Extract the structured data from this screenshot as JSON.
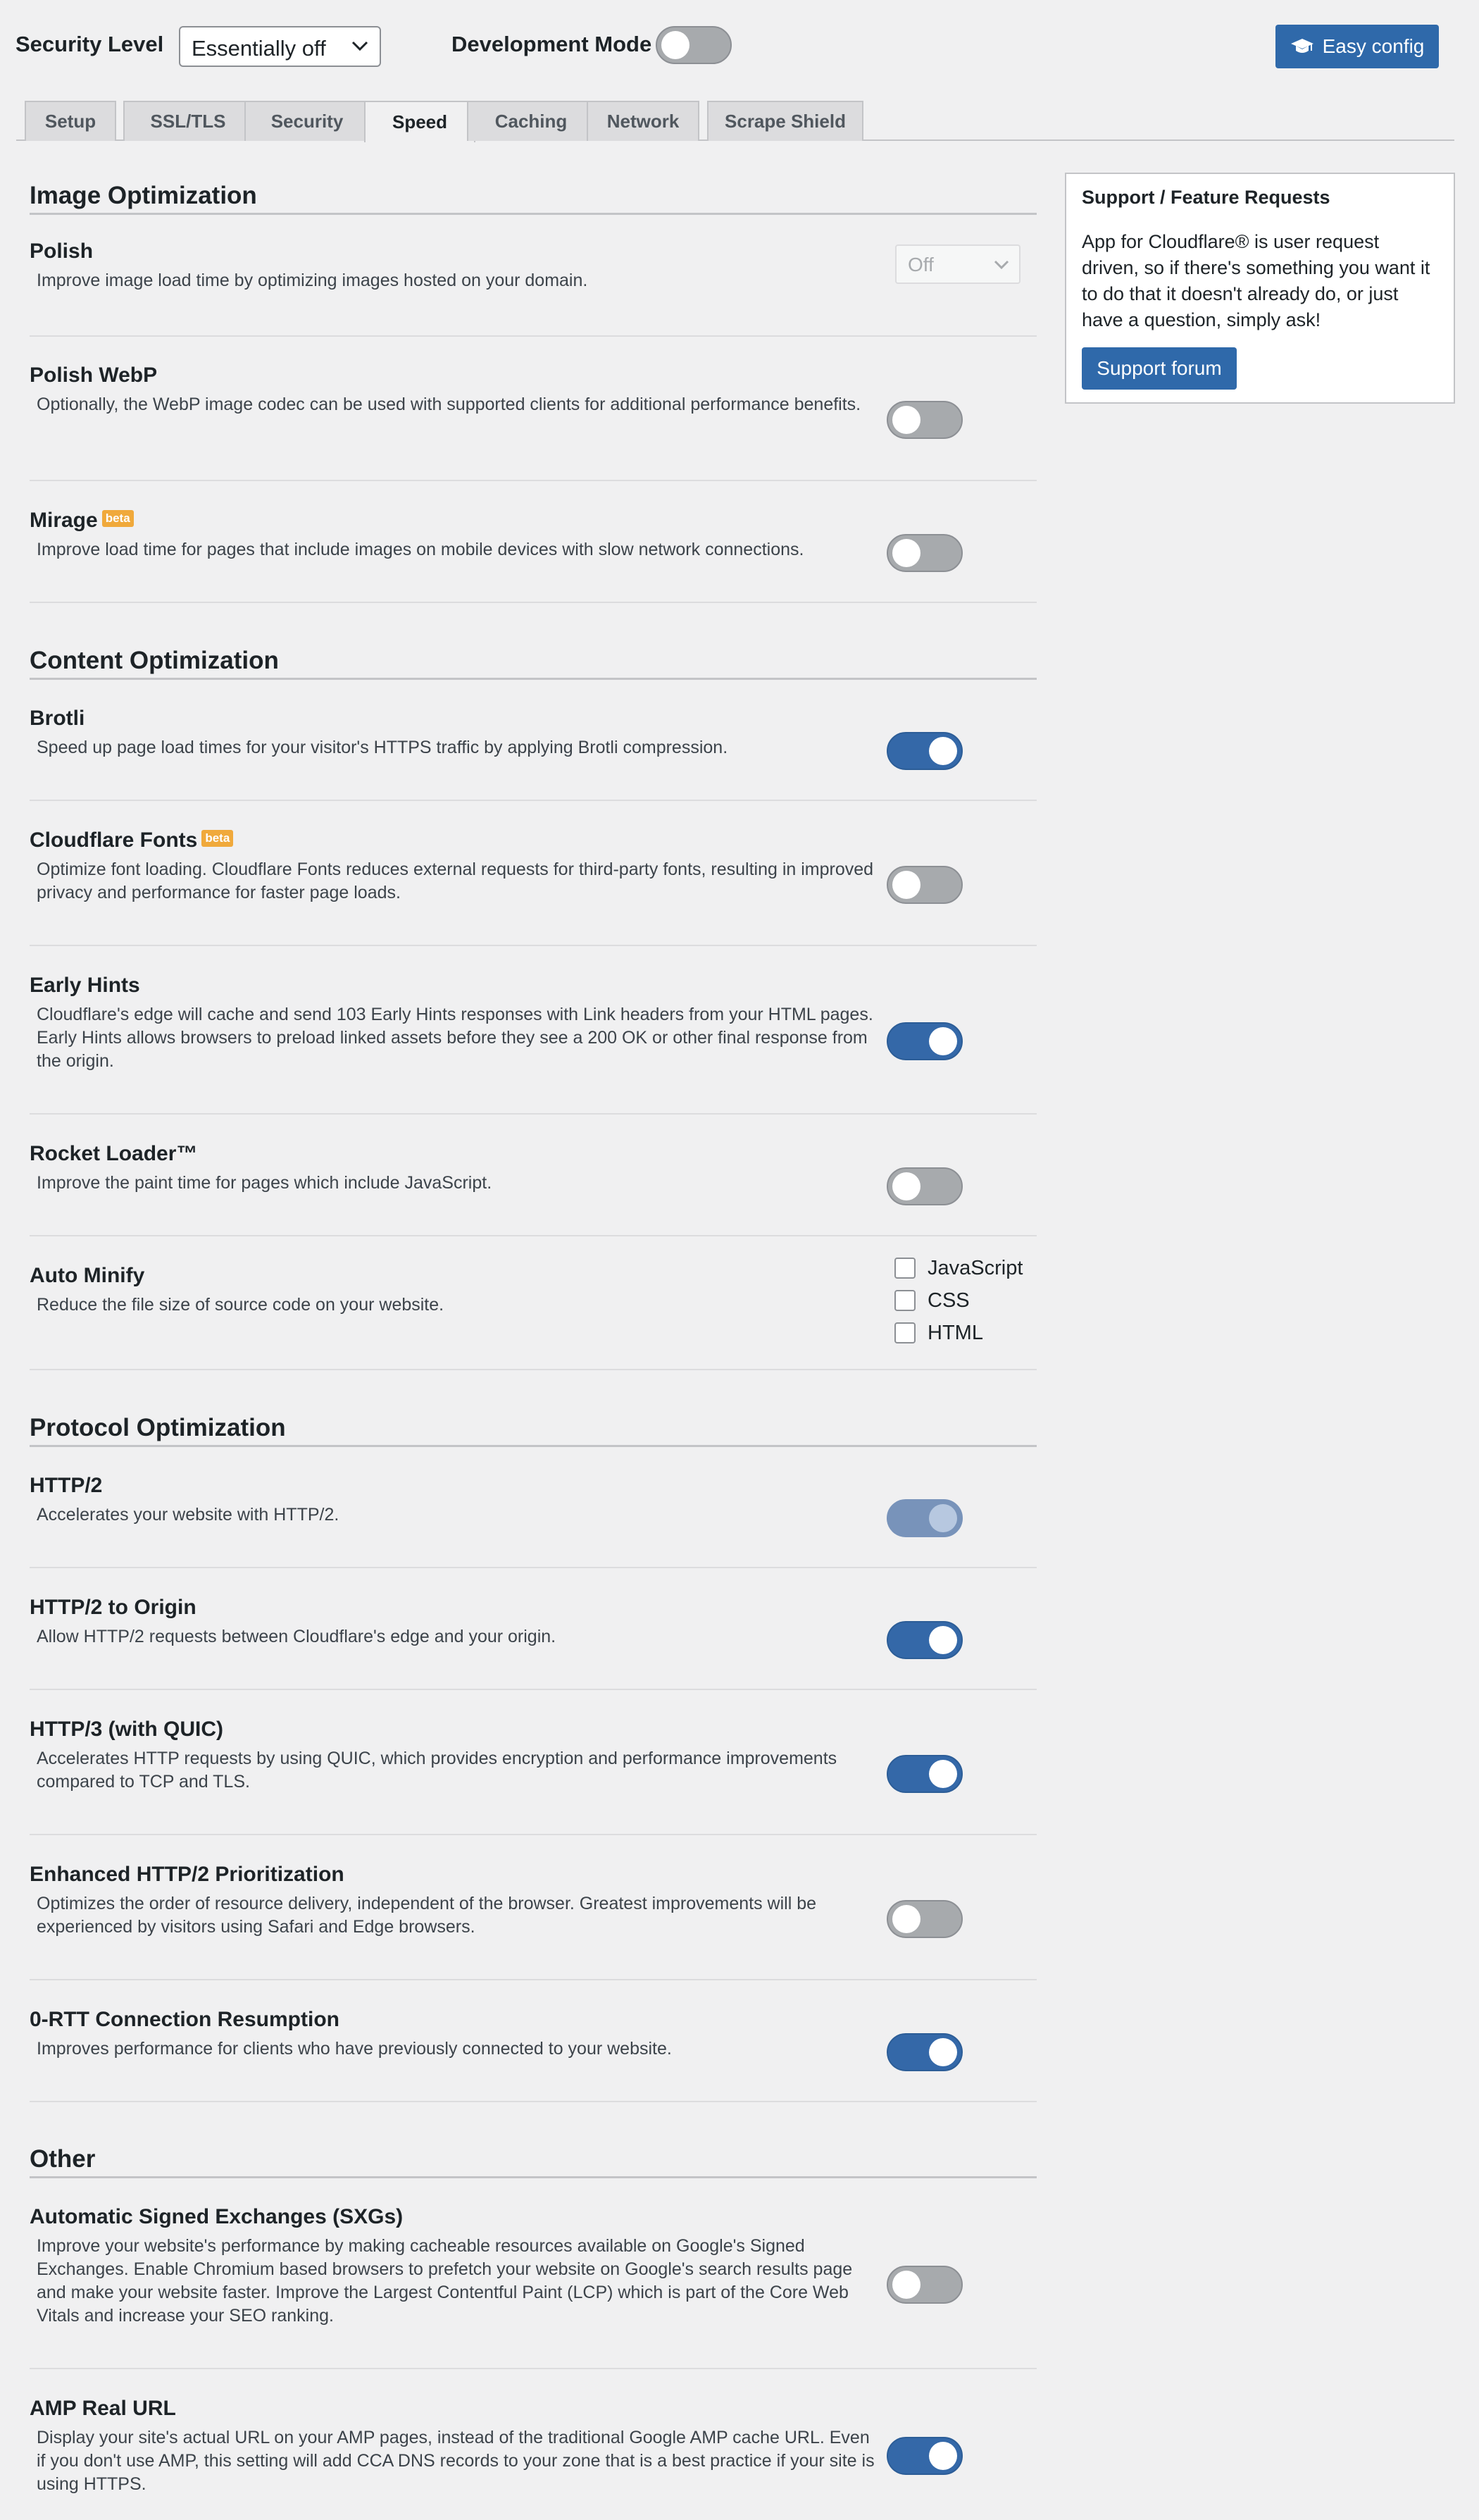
{
  "header": {
    "security_level_label": "Security Level",
    "security_level_value": "Essentially off",
    "dev_mode_label": "Development Mode",
    "dev_mode_on": false,
    "easy_config_label": "Easy config",
    "easy_config_icon": "graduation-cap-icon"
  },
  "tabs": [
    {
      "label": "Setup",
      "active": false
    },
    {
      "label": "SSL/TLS",
      "active": false
    },
    {
      "label": "Security",
      "active": false
    },
    {
      "label": "Speed",
      "active": true
    },
    {
      "label": "Caching",
      "active": false
    },
    {
      "label": "Network",
      "active": false
    },
    {
      "label": "Scrape Shield",
      "active": false
    }
  ],
  "sections": {
    "image": "Image Optimization",
    "content": "Content Optimization",
    "protocol": "Protocol Optimization",
    "other": "Other"
  },
  "settings": {
    "polish": {
      "title": "Polish",
      "desc": "Improve image load time by optimizing images hosted on your domain.",
      "value": "Off"
    },
    "polish_webp": {
      "title": "Polish WebP",
      "desc": "Optionally, the WebP image codec can be used with supported clients for additional performance benefits.",
      "on": false
    },
    "mirage": {
      "title": "Mirage",
      "badge": "beta",
      "desc": "Improve load time for pages that include images on mobile devices with slow network connections.",
      "on": false
    },
    "brotli": {
      "title": "Brotli",
      "desc": "Speed up page load times for your visitor's HTTPS traffic by applying Brotli compression.",
      "on": true
    },
    "cf_fonts": {
      "title": "Cloudflare Fonts",
      "badge": "beta",
      "desc": "Optimize font loading. Cloudflare Fonts reduces external requests for third-party fonts, resulting in improved privacy and performance for faster page loads.",
      "on": false
    },
    "early_hints": {
      "title": "Early Hints",
      "desc": "Cloudflare's edge will cache and send 103 Early Hints responses with Link headers from your HTML pages. Early Hints allows browsers to preload linked assets before they see a 200 OK or other final response from the origin.",
      "on": true
    },
    "rocket_loader": {
      "title": "Rocket Loader™",
      "desc": "Improve the paint time for pages which include JavaScript.",
      "on": false
    },
    "auto_minify": {
      "title": "Auto Minify",
      "desc": "Reduce the file size of source code on your website.",
      "options": [
        "JavaScript",
        "CSS",
        "HTML"
      ]
    },
    "http2": {
      "title": "HTTP/2",
      "desc": "Accelerates your website with HTTP/2.",
      "on": true,
      "disabled": true
    },
    "http2_origin": {
      "title": "HTTP/2 to Origin",
      "desc": "Allow HTTP/2 requests between Cloudflare's edge and your origin.",
      "on": true
    },
    "http3": {
      "title": "HTTP/3 (with QUIC)",
      "desc": "Accelerates HTTP requests by using QUIC, which provides encryption and performance improvements compared to TCP and TLS.",
      "on": true
    },
    "enhanced_h2": {
      "title": "Enhanced HTTP/2 Prioritization",
      "desc": "Optimizes the order of resource delivery, independent of the browser. Greatest improvements will be experienced by visitors using Safari and Edge browsers.",
      "on": false
    },
    "zero_rtt": {
      "title": "0-RTT Connection Resumption",
      "desc": "Improves performance for clients who have previously connected to your website.",
      "on": true
    },
    "sxg": {
      "title": "Automatic Signed Exchanges (SXGs)",
      "desc": "Improve your website's performance by making cacheable resources available on Google's Signed Exchanges. Enable Chromium based browsers to prefetch your website on Google's search results page and make your website faster. Improve the Largest Contentful Paint (LCP) which is part of the Core Web Vitals and increase your SEO ranking.",
      "on": false
    },
    "amp": {
      "title": "AMP Real URL",
      "desc": "Display your site's actual URL on your AMP pages, instead of the traditional Google AMP cache URL. Even if you don't use AMP, this setting will add CCA DNS records to your zone that is a best practice if your site is using HTTPS.",
      "on": true
    }
  },
  "sidebar": {
    "title": "Support / Feature Requests",
    "body": "App for Cloudflare® is user request driven, so if there's something you want it to do that it doesn't already do, or just have a question, simply ask!",
    "button": "Support forum"
  },
  "colors": {
    "primary": "#2f69aa",
    "toggle_on": "#3468a8",
    "toggle_off": "#a7aaad",
    "badge": "#f0a93b",
    "background": "#f0f0f1"
  }
}
